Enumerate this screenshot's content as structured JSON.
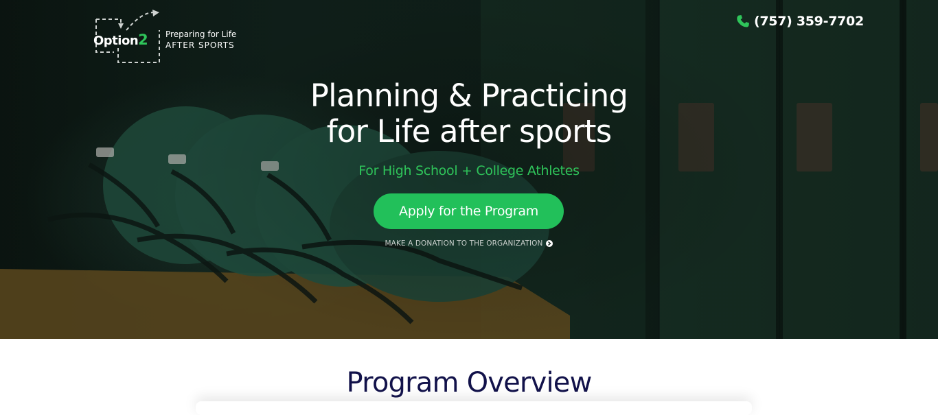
{
  "header": {
    "logo": {
      "brand": "Option",
      "brand_number": "2",
      "tagline_line1": "Preparing for Life",
      "tagline_line2": "AFTER SPORTS"
    },
    "phone": {
      "icon": "phone-icon",
      "number": "(757) 359-7702"
    }
  },
  "hero": {
    "headline_line1": "Planning & Practicing",
    "headline_line2": "for Life after sports",
    "subheadline": "For High School + College Athletes",
    "cta_label": "Apply for the Program",
    "donate_label": "MAKE A DONATION TO THE ORGANIZATION",
    "donate_icon": "chevron-right-circle-icon"
  },
  "overview": {
    "title": "Program Overview"
  },
  "colors": {
    "accent_green": "#22c05a",
    "subhead_green": "#2fc45a",
    "heading_navy": "#12124a",
    "hero_bg": "#0f1e18"
  }
}
